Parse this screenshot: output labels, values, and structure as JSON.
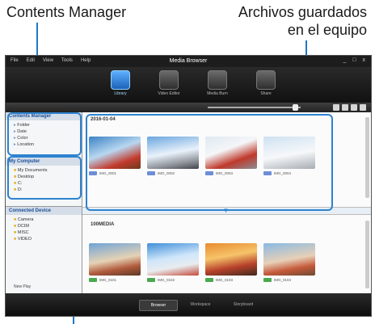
{
  "callouts": {
    "left": "Contents Manager",
    "right_line1": "Archivos guardados",
    "right_line2": "en el equipo"
  },
  "app": {
    "title": "Media Browser",
    "menu": [
      "File",
      "Edit",
      "View",
      "Tools",
      "Help"
    ],
    "window_buttons": "_ □ x",
    "modes": [
      {
        "label": "Library",
        "active": true
      },
      {
        "label": "Video Editor",
        "active": false
      },
      {
        "label": "Media Burn",
        "active": false
      },
      {
        "label": "Share",
        "active": false
      }
    ],
    "sidebar": {
      "contents_manager_title": "Contents Manager",
      "contents_items": [
        "Folder",
        "Date",
        "Color",
        "Location"
      ],
      "computer_title": "My Computer",
      "computer_items": [
        "My Documents",
        "Desktop",
        "C:",
        "D:"
      ],
      "devices_title": "Connected Device",
      "device_items": [
        "Camera",
        "DCIM",
        "MISC",
        "VIDEO"
      ],
      "new_playlist": "New Play"
    },
    "main": {
      "top_group_label": "2016-01-04",
      "top_items": [
        "IMG_0001",
        "IMG_0002",
        "IMG_0003",
        "IMG_0004"
      ],
      "bottom_group_label": "100MEDIA",
      "bottom_items": [
        "IMG_0101",
        "IMG_0102",
        "IMG_0103",
        "IMG_0104"
      ]
    },
    "bottom_tabs": [
      "Browser",
      "Workspace",
      "Storyboard"
    ]
  }
}
